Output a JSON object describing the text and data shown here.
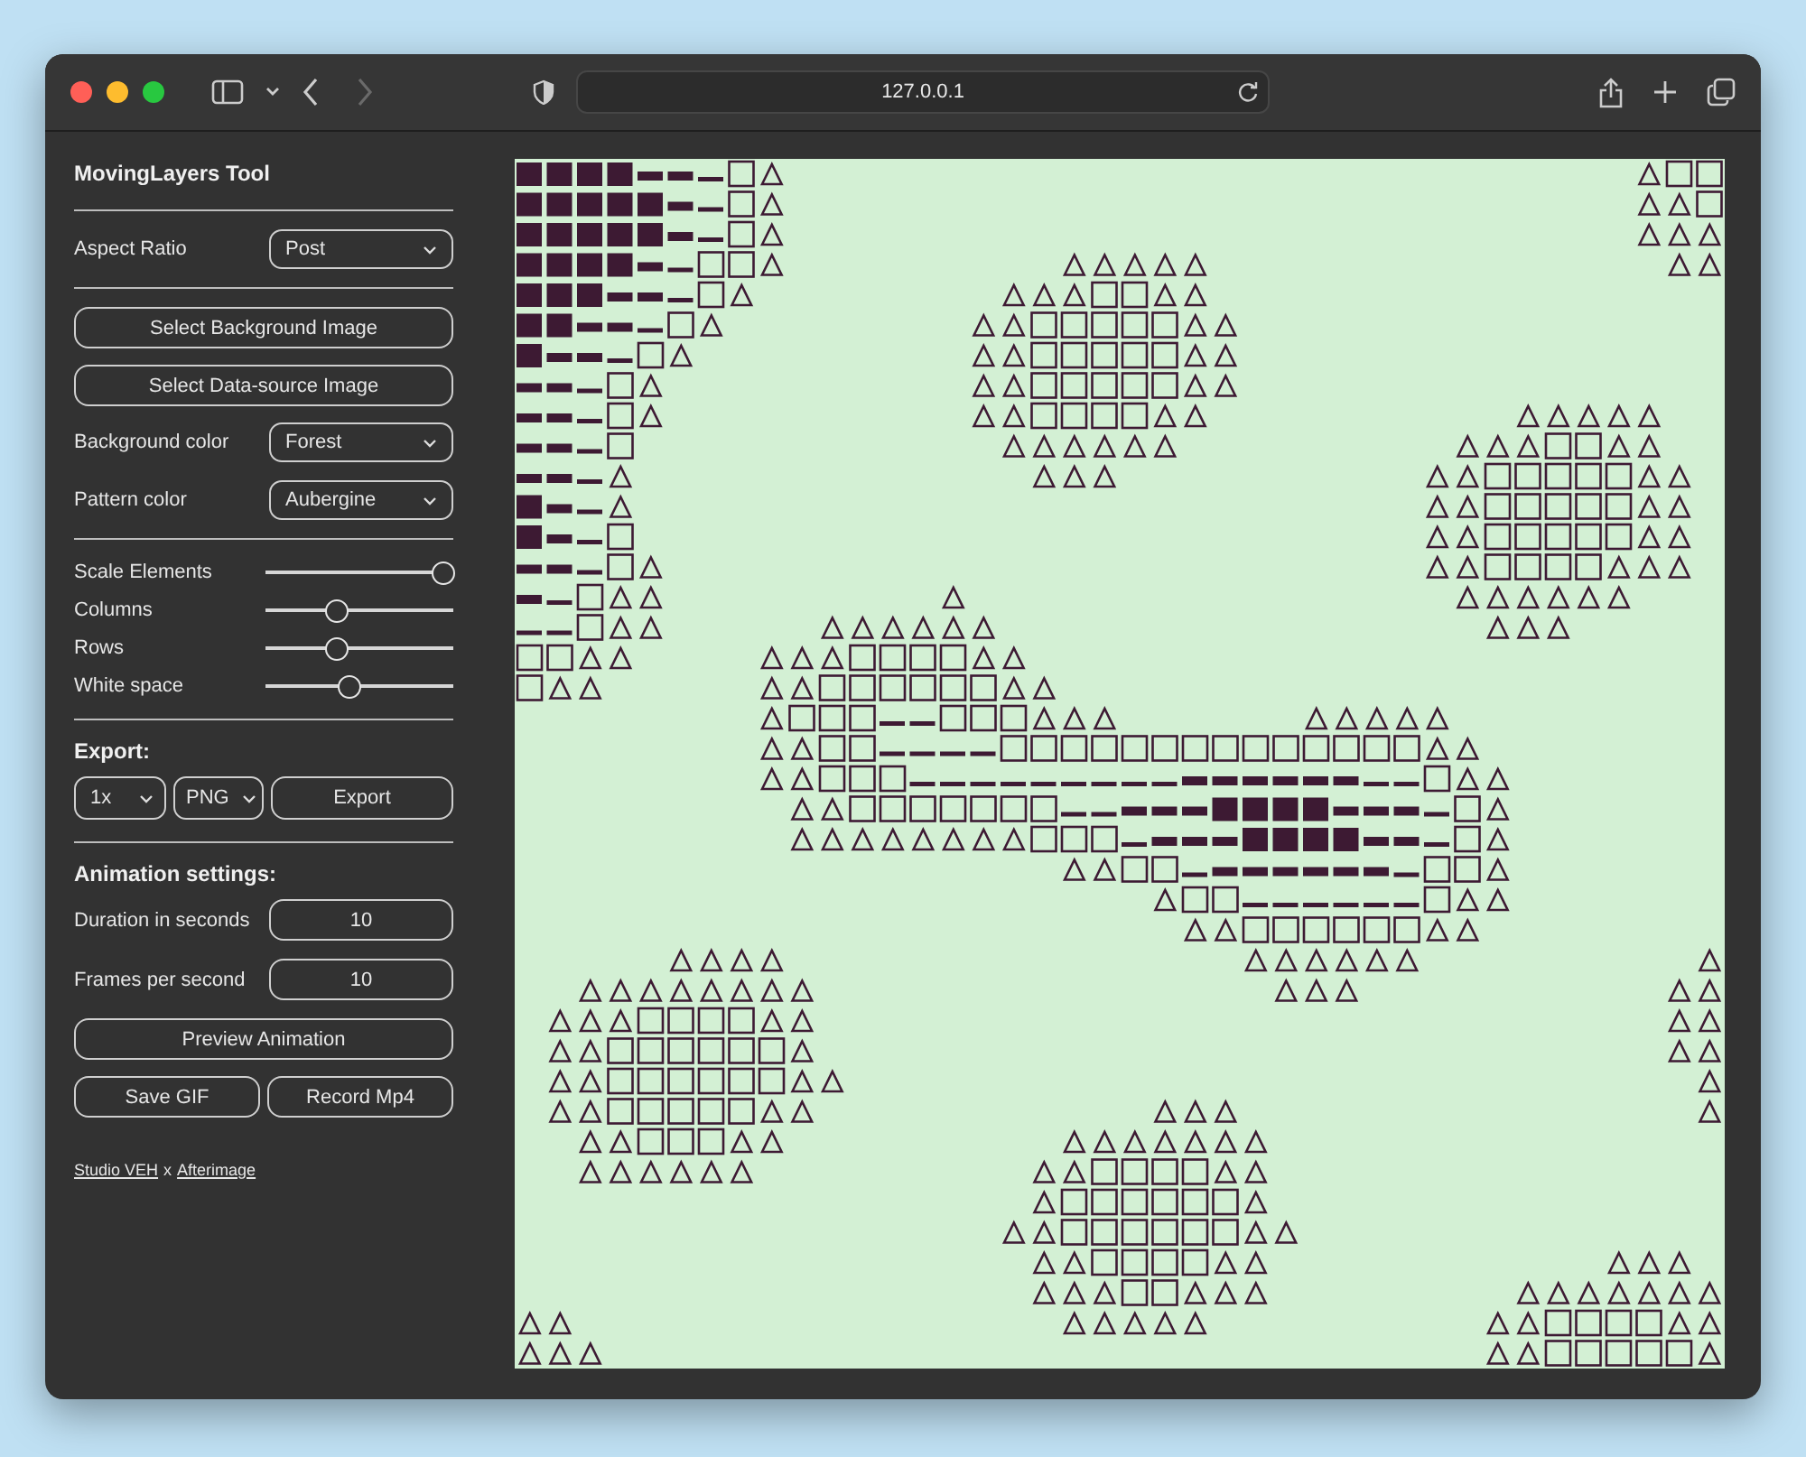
{
  "browser": {
    "address": "127.0.0.1",
    "back_disabled": false,
    "forward_disabled": true
  },
  "sidebar": {
    "title": "MovingLayers Tool",
    "aspect_ratio": {
      "label": "Aspect Ratio",
      "value": "Post"
    },
    "image_buttons": [
      "Select Background Image",
      "Select Data-source Image"
    ],
    "colors": [
      {
        "label": "Background color",
        "value": "Forest"
      },
      {
        "label": "Pattern color",
        "value": "Aubergine"
      }
    ],
    "sliders": [
      {
        "label": "Scale Elements",
        "level": 1.0
      },
      {
        "label": "Columns",
        "level": 0.36
      },
      {
        "label": "Rows",
        "level": 0.36
      },
      {
        "label": "White space",
        "level": 0.44
      }
    ],
    "export": {
      "heading": "Export:",
      "scale": "1x",
      "format": "PNG",
      "button": "Export"
    },
    "animation": {
      "heading": "Animation settings:",
      "fields": [
        {
          "label": "Duration in seconds",
          "value": "10"
        },
        {
          "label": "Frames per second",
          "value": "10"
        }
      ],
      "preview_button": "Preview Animation",
      "buttons": [
        "Save GIF",
        "Record Mp4"
      ]
    },
    "credits": {
      "link_1": "Studio VEH",
      "separator": "x",
      "link_2": "Afterimage"
    }
  }
}
